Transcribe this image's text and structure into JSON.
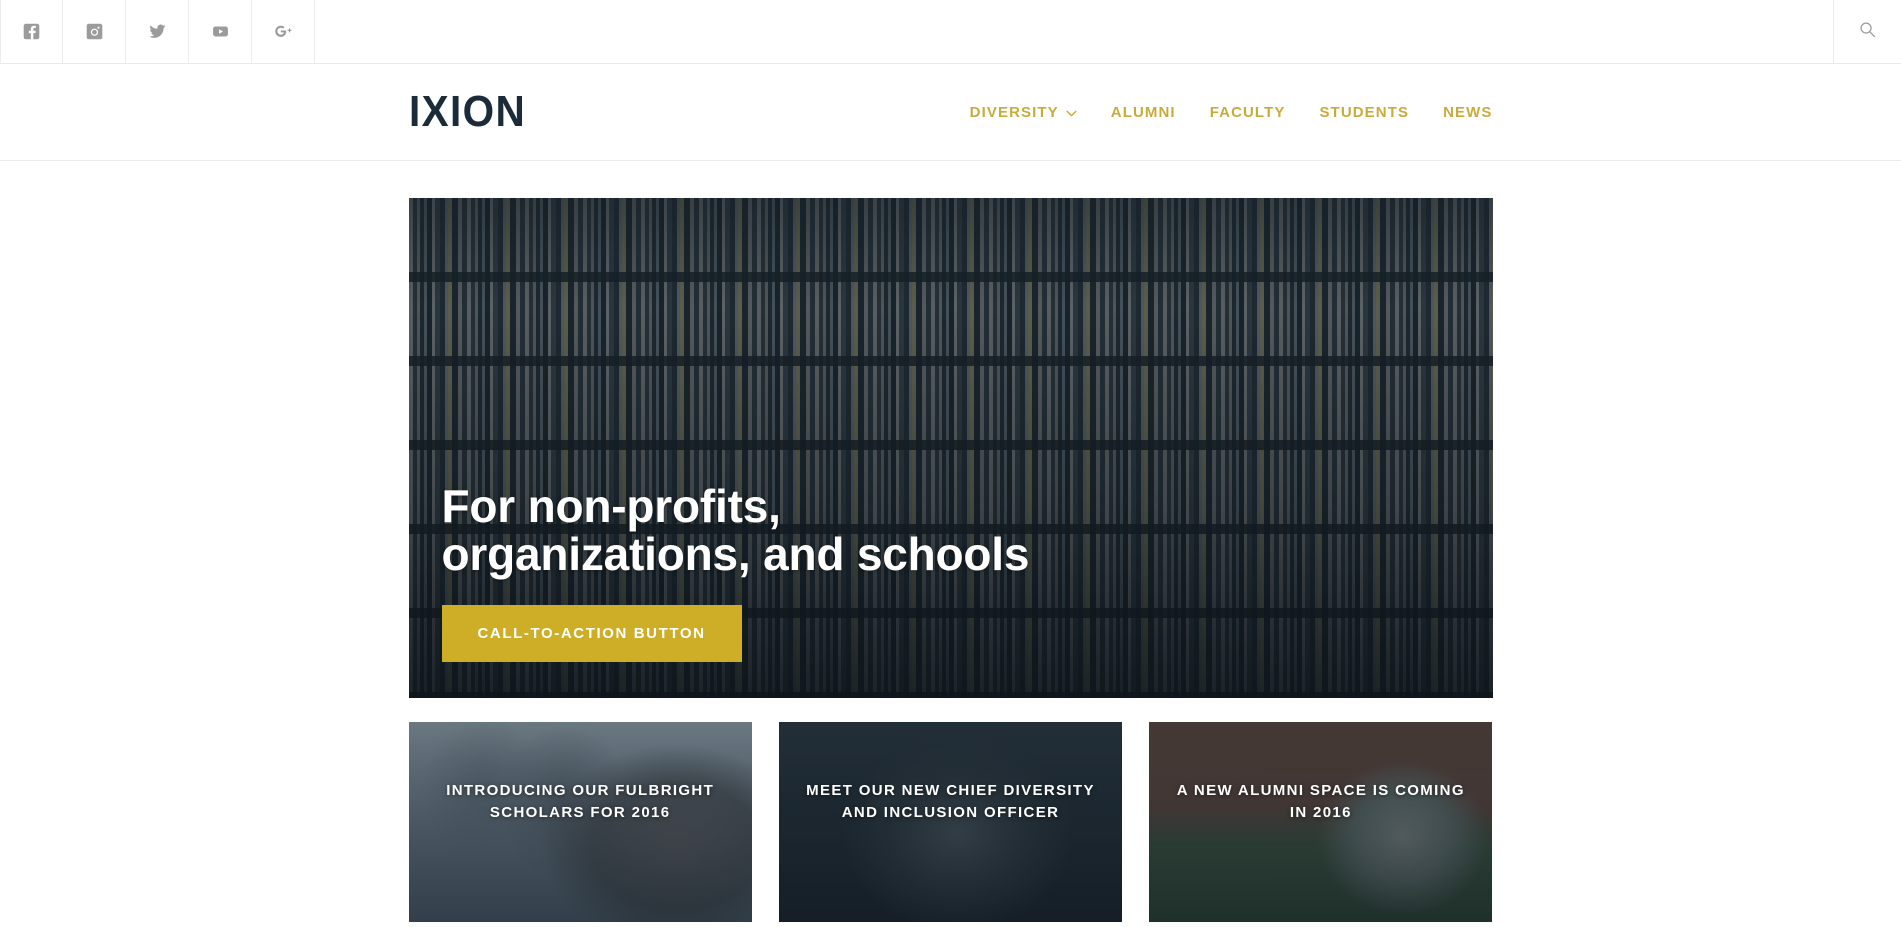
{
  "social_bar": {
    "items": [
      {
        "name": "facebook",
        "label": "Facebook"
      },
      {
        "name": "instagram",
        "label": "Instagram"
      },
      {
        "name": "twitter",
        "label": "Twitter"
      },
      {
        "name": "youtube",
        "label": "YouTube"
      },
      {
        "name": "googleplus",
        "label": "Google Plus"
      }
    ],
    "search_label": "Search"
  },
  "header": {
    "logo": "IXION",
    "nav": [
      {
        "label": "DIVERSITY",
        "has_dropdown": true
      },
      {
        "label": "ALUMNI",
        "has_dropdown": false
      },
      {
        "label": "FACULTY",
        "has_dropdown": false
      },
      {
        "label": "STUDENTS",
        "has_dropdown": false
      },
      {
        "label": "NEWS",
        "has_dropdown": false
      }
    ]
  },
  "hero": {
    "title": "For non-profits, organizations, and schools",
    "cta_label": "CALL-TO-ACTION BUTTON"
  },
  "cards": [
    {
      "title": "INTRODUCING OUR FULBRIGHT SCHOLARS FOR 2016"
    },
    {
      "title": "MEET OUR NEW CHIEF DIVERSITY AND INCLUSION OFFICER"
    },
    {
      "title": "A NEW ALUMNI SPACE IS COMING IN 2016"
    }
  ],
  "colors": {
    "gold": "#c9ab3c",
    "cta_gold": "#ceae26",
    "logo_navy": "#1c2b39",
    "icon_gray": "#9b9b9b"
  }
}
